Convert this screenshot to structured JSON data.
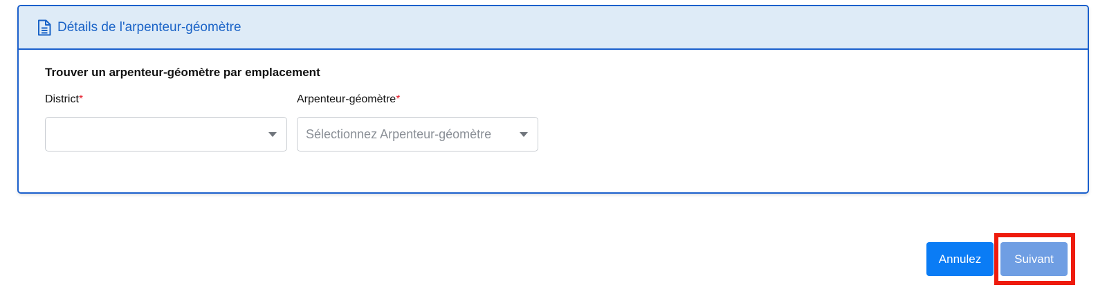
{
  "card": {
    "header_title": "Détails de l'arpenteur-géomètre",
    "header_icon": "document-icon",
    "section_title": "Trouver un arpenteur-géomètre par emplacement"
  },
  "fields": {
    "district": {
      "label": "District",
      "required_mark": "*",
      "value": ""
    },
    "arpenteur": {
      "label": "Arpenteur-géomètre",
      "required_mark": "*",
      "placeholder": "Sélectionnez Arpenteur-géomètre"
    }
  },
  "actions": {
    "cancel_label": "Annulez",
    "next_label": "Suivant"
  },
  "colors": {
    "primary": "#0a7cf5",
    "header_bg": "#deebf7",
    "border": "#1a5fcc",
    "required": "#e5202e",
    "highlight": "#ee1b0d",
    "next_disabled": "#6f9ee3"
  }
}
